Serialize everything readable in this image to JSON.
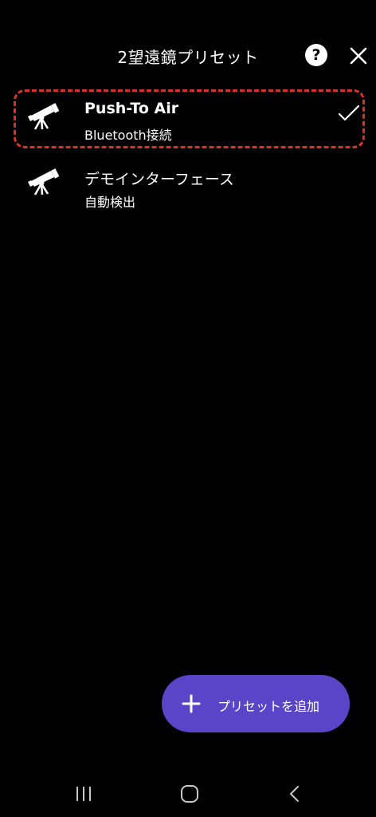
{
  "header": {
    "title": "2望遠鏡プリセット",
    "help_label": "?"
  },
  "presets": [
    {
      "name": "Push-To Air",
      "subtitle": "Bluetooth接続",
      "icon": "telescope-icon",
      "selected": true
    },
    {
      "name": "デモインターフェース",
      "subtitle": "自動検出",
      "icon": "telescope-icon",
      "selected": false
    }
  ],
  "fab": {
    "label": "プリセットを追加",
    "icon": "plus-icon"
  },
  "colors": {
    "background": "#000000",
    "accent": "#5a45c8",
    "selection_outline": "#d6332b",
    "text": "#ffffff"
  },
  "navbar": {
    "icons": [
      "recent-apps-icon",
      "home-icon",
      "back-icon"
    ]
  }
}
